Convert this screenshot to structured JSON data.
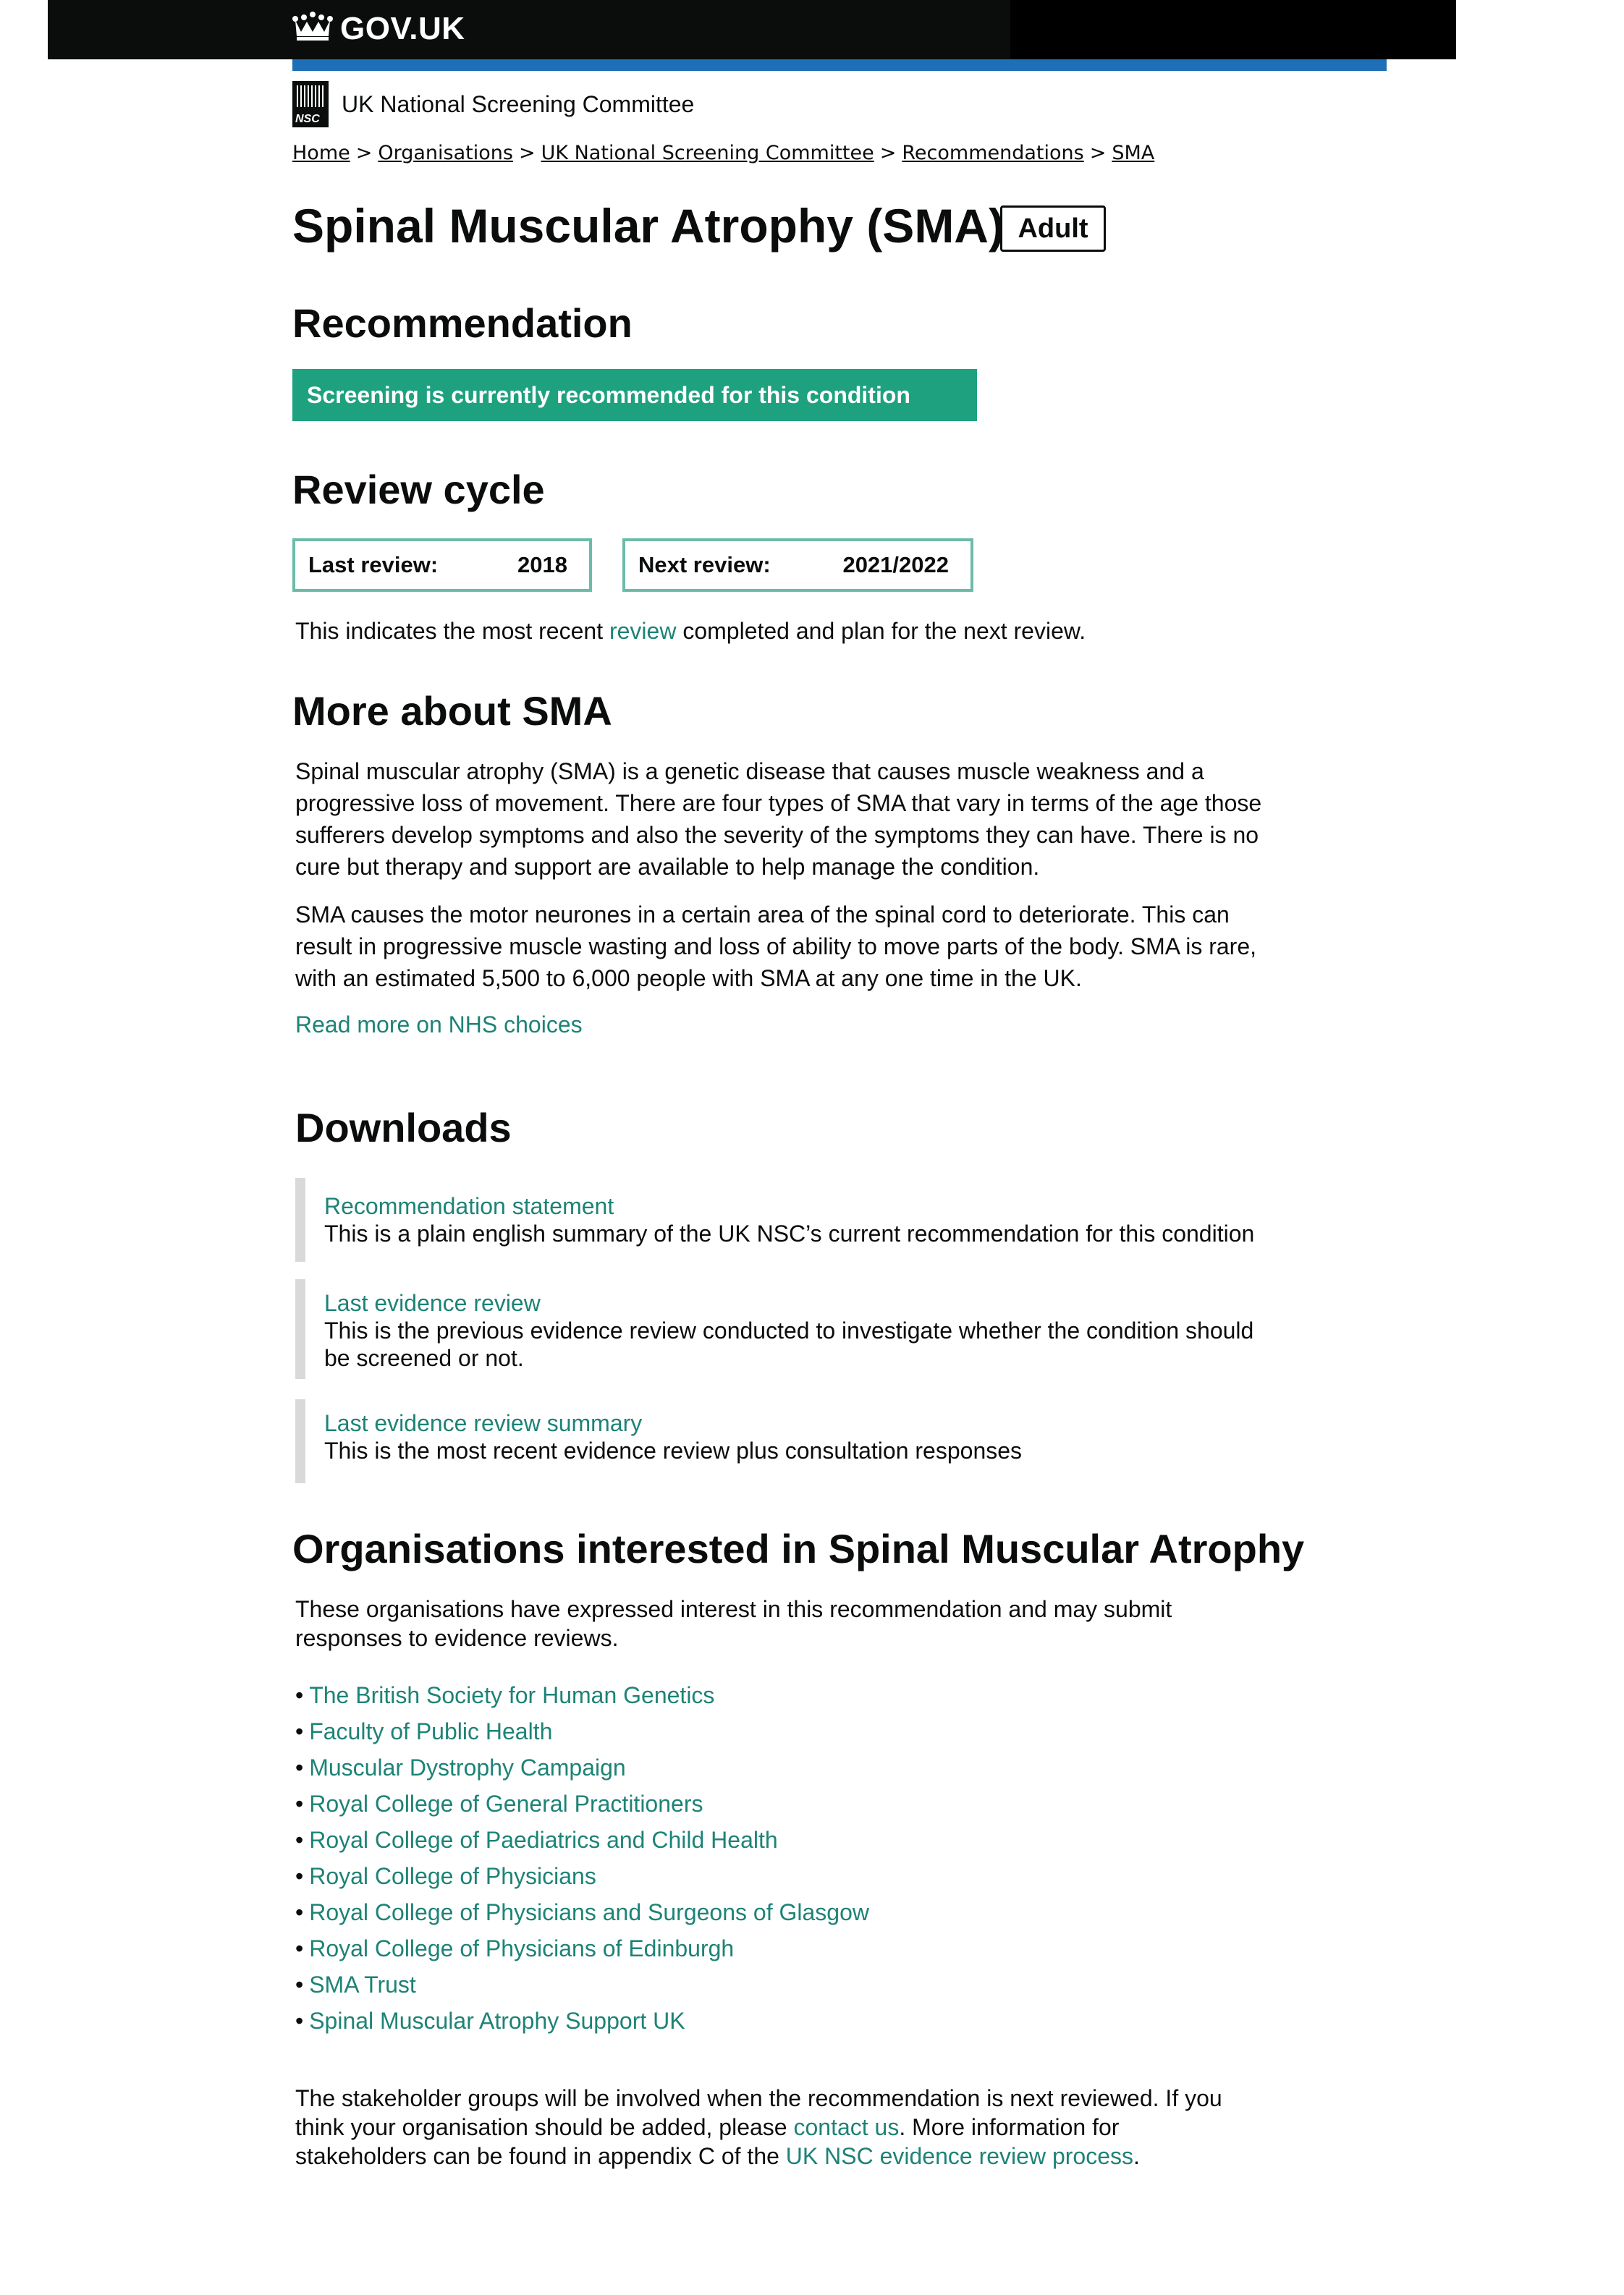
{
  "header": {
    "logo_text": "GOV.UK"
  },
  "org": {
    "logo_text": "NSC",
    "name": "UK National Screening Committee"
  },
  "breadcrumb": [
    "Home",
    "Organisations",
    "UK National Screening Committee",
    "Recommendations",
    "SMA"
  ],
  "page": {
    "title": "Spinal Muscular Atrophy (SMA)",
    "tag": "Adult"
  },
  "recommendation": {
    "heading": "Recommendation",
    "banner": "Screening is currently recommended for this condition",
    "banner_color": "#1ea17f"
  },
  "review_cycle": {
    "heading": "Review cycle",
    "last_label": "Last review:",
    "last_value": "2018",
    "next_label": "Next review:",
    "next_value": "2021/2022",
    "note_before": "This indicates the most recent ",
    "note_link": "review",
    "note_after": " completed and plan for the next review."
  },
  "more": {
    "heading": "More about SMA",
    "para1": "Spinal muscular atrophy (SMA) is a genetic disease that causes muscle weakness and a progressive loss of movement. There are four types of SMA that vary in terms of the age those sufferers develop symptoms and also the severity of the symptoms they can have. There is no cure but therapy and support are available to help manage the condition.",
    "para2": "SMA causes the motor neurones in a certain area of the spinal cord to deteriorate. This can result in progressive muscle wasting and loss of ability to move parts of the body. SMA is rare, with an estimated 5,500 to 6,000 people with SMA at any one time in the UK.",
    "link": "Read more on NHS choices"
  },
  "downloads": {
    "heading": "Downloads",
    "items": [
      {
        "title": "Recommendation statement",
        "desc": "This is a plain english summary of the UK NSC’s current recommendation for this condition"
      },
      {
        "title": "Last evidence review",
        "desc": "This is the previous evidence review conducted to investigate whether the condition should be screened or not."
      },
      {
        "title": "Last evidence review summary",
        "desc": "This is the most recent evidence review plus consultation responses"
      }
    ]
  },
  "organisations": {
    "heading": "Organisations interested in Spinal Muscular Atrophy",
    "intro": "These organisations have expressed interest in this recommendation and may submit responses to evidence reviews.",
    "items": [
      "The British Society for Human Genetics",
      "Faculty of Public Health",
      "Muscular Dystrophy Campaign",
      "Royal College of General Practitioners",
      "Royal College of Paediatrics and Child Health",
      "Royal College of Physicians",
      "Royal College of Physicians and Surgeons of Glasgow",
      "Royal College of Physicians of Edinburgh",
      "SMA Trust",
      "Spinal Muscular Atrophy Support UK"
    ]
  },
  "stakeholders": {
    "text1": "The stakeholder groups will be involved when the recommendation is next reviewed. If you think your organisation should be added, please ",
    "link1": "contact us",
    "text2": ". More information for stakeholders can be found in appendix C of the ",
    "link2": "UK NSC evidence review process",
    "text3": "."
  },
  "colors": {
    "header": "#0b0c0c",
    "blue_bar": "#1d70b8",
    "link": "#1d8376",
    "box_border": "#6cbba9"
  }
}
